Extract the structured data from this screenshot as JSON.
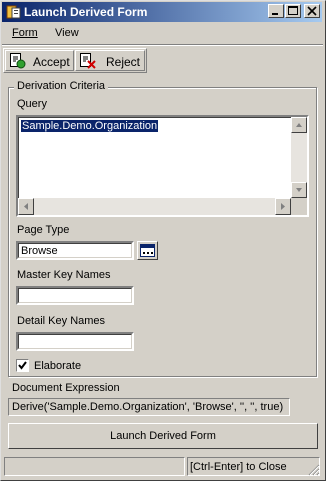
{
  "window": {
    "title": "Launch Derived Form"
  },
  "menu": {
    "form_label": "Form",
    "view_label": "View"
  },
  "toolbar": {
    "accept_label": "Accept",
    "reject_label": "Reject"
  },
  "criteria": {
    "group_title": "Derivation Criteria",
    "query_label": "Query",
    "query_value": "Sample.Demo.Organization",
    "page_type_label": "Page Type",
    "page_type_value": "Browse",
    "master_key_label": "Master Key Names",
    "master_key_value": "",
    "detail_key_label": "Detail Key Names",
    "detail_key_value": "",
    "elaborate_label": "Elaborate",
    "elaborate_checked": true
  },
  "expression": {
    "label": "Document Expression",
    "value": "Derive('Sample.Demo.Organization', 'Browse', '', '', true)"
  },
  "launch_button_label": "Launch Derived Form",
  "status": {
    "left_text": "",
    "right_text": "[Ctrl-Enter] to Close"
  },
  "icons": {
    "app": "derived-form-icon",
    "accept": "accept-page-icon",
    "reject": "reject-page-icon",
    "lookup": "lookup-icon"
  }
}
